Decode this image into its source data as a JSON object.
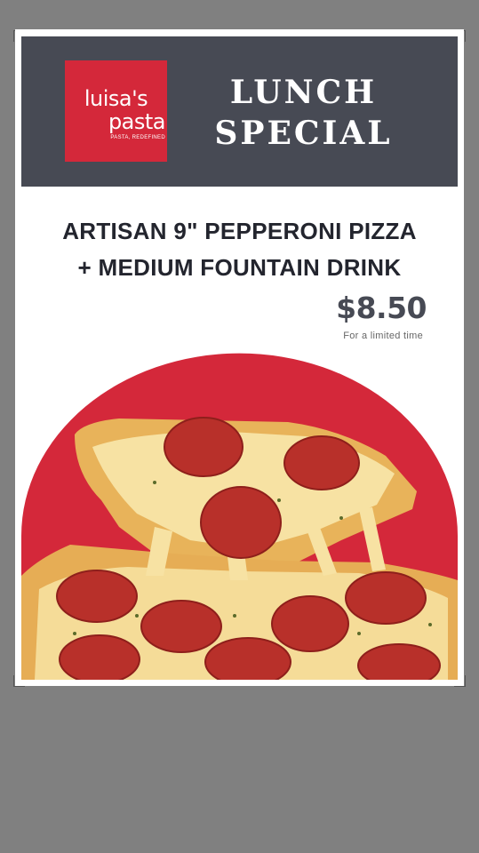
{
  "logo": {
    "line1": "luisa's",
    "line2": "pasta",
    "tagline": "PASTA, REDEFINED"
  },
  "header": {
    "title_line1": "LUNCH",
    "title_line2": "SPECIAL"
  },
  "offer": {
    "line1": "ARTISAN 9\" PEPPERONI PIZZA",
    "line2": "+ MEDIUM FOUNTAIN DRINK"
  },
  "price": "$8.50",
  "note": "For a limited time",
  "colors": {
    "background": "#808080",
    "header_bg": "#474a54",
    "brand_red": "#d4283a",
    "text_dark": "#23252e"
  },
  "image": "pepperoni-pizza-slice-photo"
}
